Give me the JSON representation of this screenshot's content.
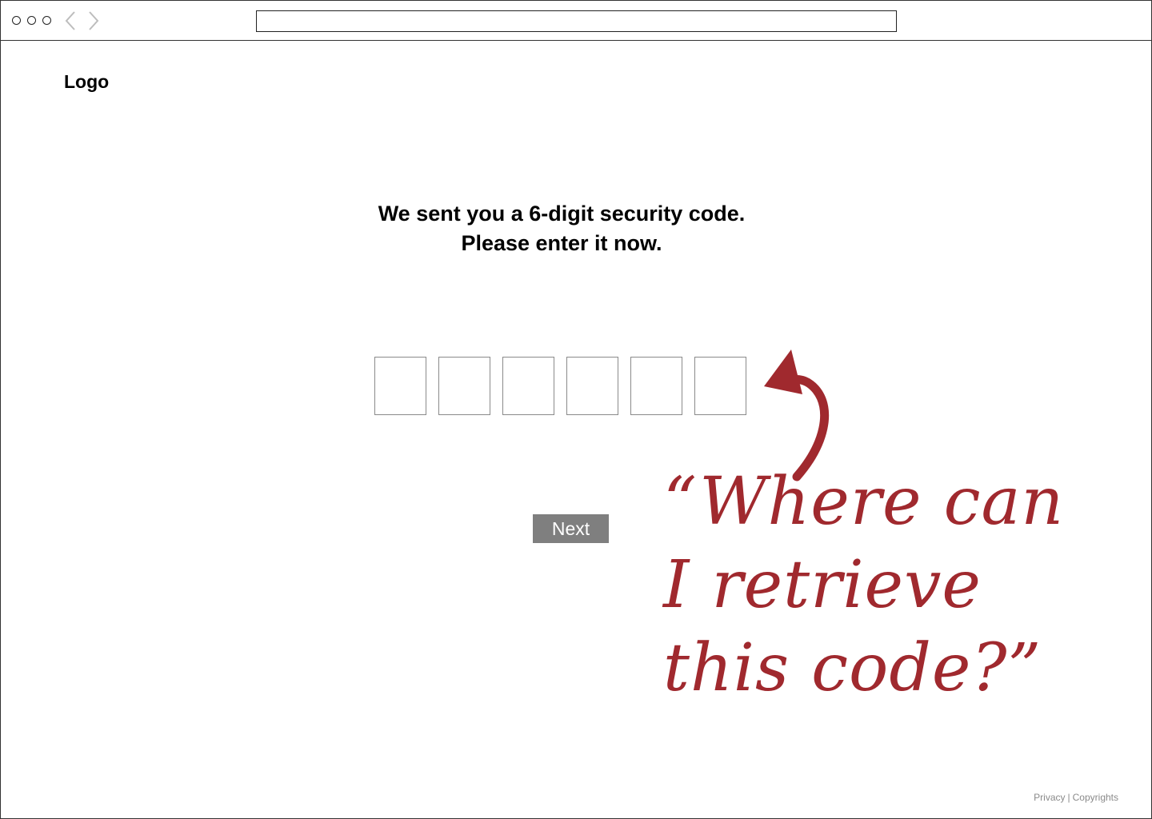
{
  "browser": {
    "address": ""
  },
  "header": {
    "logo": "Logo"
  },
  "main": {
    "heading": "We sent you a 6-digit security code. Please enter it now.",
    "code_digits": [
      "",
      "",
      "",
      "",
      "",
      ""
    ],
    "next_label": "Next"
  },
  "annotation": {
    "text": "“Where can I retrieve this code?”",
    "color": "#a0292e"
  },
  "footer": {
    "privacy": "Privacy",
    "separator": "|",
    "copyrights": "Copyrights"
  }
}
